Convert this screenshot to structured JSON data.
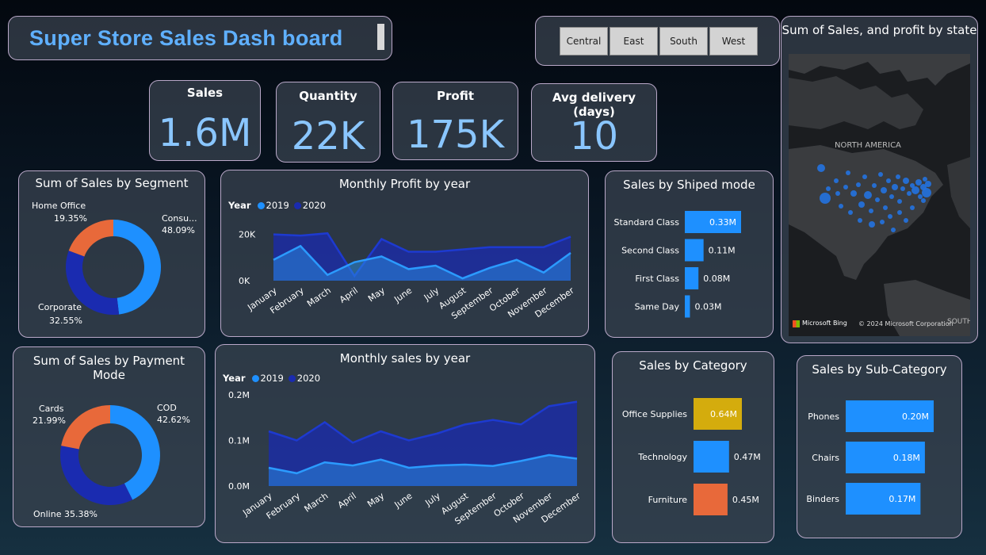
{
  "header": {
    "title": "Super Store Sales Dash board"
  },
  "slicer": {
    "regions": [
      "Central",
      "East",
      "South",
      "West"
    ]
  },
  "kpis": {
    "sales": {
      "label": "Sales",
      "value": "1.6M"
    },
    "quantity": {
      "label": "Quantity",
      "value": "22K"
    },
    "profit": {
      "label": "Profit",
      "value": "175K"
    },
    "delivery": {
      "label": "Avg delivery (days)",
      "value": "10"
    }
  },
  "map": {
    "title": "Sum of Sales, and profit by state",
    "region_label": "NORTH AMERICA",
    "south_label": "SOUTH",
    "attribution_logo": "Microsoft Bing",
    "copyright": "© 2024 Microsoft Corporation"
  },
  "colors": {
    "light_blue": "#1e90ff",
    "dark_blue": "#1a2bb0",
    "orange": "#e8693a",
    "gold": "#d4ac0d",
    "accent_text": "#5fb0ff"
  },
  "months": [
    "January",
    "February",
    "March",
    "April",
    "May",
    "June",
    "July",
    "August",
    "September",
    "October",
    "November",
    "December"
  ],
  "legend_year_label": "Year",
  "years": [
    "2019",
    "2020"
  ],
  "chart_data": [
    {
      "id": "segment",
      "type": "pie",
      "title": "Sum of Sales by Segment",
      "slices": [
        {
          "name": "Consu...",
          "value": 48.09,
          "label": "48.09%",
          "color": "#1e90ff"
        },
        {
          "name": "Corporate",
          "value": 32.55,
          "label": "32.55%",
          "color": "#1a2bb0"
        },
        {
          "name": "Home Office",
          "value": 19.35,
          "label": "19.35%",
          "color": "#e8693a"
        }
      ]
    },
    {
      "id": "payment",
      "type": "pie",
      "title": "Sum of Sales by Payment Mode",
      "slices": [
        {
          "name": "COD",
          "value": 42.62,
          "label": "42.62%",
          "color": "#1e90ff"
        },
        {
          "name": "Online",
          "value": 35.38,
          "label": "35.38%",
          "color": "#1a2bb0"
        },
        {
          "name": "Cards",
          "value": 21.99,
          "label": "21.99%",
          "color": "#e8693a"
        }
      ]
    },
    {
      "id": "profit_monthly",
      "type": "area",
      "title": "Monthly Profit by year",
      "categories": [
        "January",
        "February",
        "March",
        "April",
        "May",
        "June",
        "July",
        "August",
        "September",
        "October",
        "November",
        "December"
      ],
      "series": [
        {
          "name": "2020",
          "values": [
            20000,
            19500,
            20500,
            2000,
            18000,
            12500,
            12500,
            13500,
            14500,
            14500,
            14500,
            19000
          ]
        },
        {
          "name": "2019",
          "values": [
            9000,
            15000,
            2500,
            8000,
            10500,
            5000,
            6500,
            1000,
            5500,
            9000,
            3500,
            12000
          ]
        }
      ],
      "ylim": [
        0,
        24000
      ],
      "yticks": [
        "0K",
        "20K"
      ]
    },
    {
      "id": "sales_monthly",
      "type": "area",
      "title": "Monthly sales by year",
      "categories": [
        "January",
        "February",
        "March",
        "April",
        "May",
        "June",
        "July",
        "August",
        "September",
        "October",
        "November",
        "December"
      ],
      "series": [
        {
          "name": "2020",
          "values": [
            120000,
            100000,
            140000,
            95000,
            120000,
            100000,
            115000,
            135000,
            145000,
            135000,
            175000,
            185000
          ]
        },
        {
          "name": "2019",
          "values": [
            40000,
            28000,
            52000,
            45000,
            58000,
            40000,
            45000,
            47000,
            44000,
            55000,
            68000,
            60000
          ]
        }
      ],
      "ylim": [
        0,
        200000
      ],
      "yticks": [
        "0.0M",
        "0.1M",
        "0.2M"
      ]
    },
    {
      "id": "ship_mode",
      "type": "bar",
      "title": "Sales by Shiped mode",
      "categories": [
        "Standard Class",
        "Second Class",
        "First Class",
        "Same Day"
      ],
      "values": [
        0.33,
        0.11,
        0.08,
        0.03
      ],
      "labels": [
        "0.33M",
        "0.11M",
        "0.08M",
        "0.03M"
      ],
      "color": "#1e90ff"
    },
    {
      "id": "category",
      "type": "bar",
      "title": "Sales by Category",
      "categories": [
        "Office Supplies",
        "Technology",
        "Furniture"
      ],
      "values": [
        0.64,
        0.47,
        0.45
      ],
      "labels": [
        "0.64M",
        "0.47M",
        "0.45M"
      ],
      "colors": [
        "#d4ac0d",
        "#1e90ff",
        "#e8693a"
      ]
    },
    {
      "id": "subcategory",
      "type": "bar",
      "title": "Sales by Sub-Category",
      "categories": [
        "Phones",
        "Chairs",
        "Binders"
      ],
      "values": [
        0.2,
        0.18,
        0.17
      ],
      "labels": [
        "0.20M",
        "0.18M",
        "0.17M"
      ],
      "color": "#1e90ff"
    }
  ]
}
